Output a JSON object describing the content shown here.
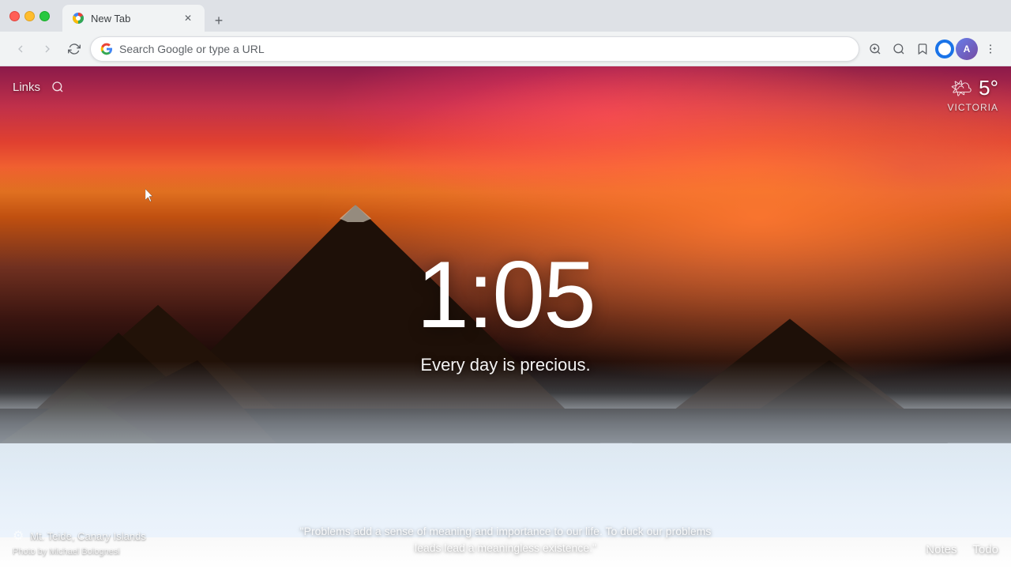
{
  "titleBar": {
    "tabTitle": "New Tab",
    "newTabTooltip": "New tab"
  },
  "navBar": {
    "searchPlaceholder": "Search Google or type a URL",
    "backDisabled": true,
    "forwardDisabled": true
  },
  "topLeft": {
    "linksLabel": "Links",
    "searchIconLabel": "🔍"
  },
  "weather": {
    "icon": "🌤",
    "temperature": "5°",
    "location": "VICTORIA"
  },
  "clock": {
    "time": "1:05",
    "quote": "Every day is precious."
  },
  "bottomLeft": {
    "photoLocation": "Mt. Teide, Canary Islands",
    "photoCredit": "Photo by Michael Bolognesi"
  },
  "bottomQuote": {
    "text": "\"Problems add a sense of meaning and importance to our life. To duck our problems leads lead a meaningless existence.\""
  },
  "bottomRight": {
    "notesLabel": "Notes",
    "todoLabel": "Todo"
  }
}
